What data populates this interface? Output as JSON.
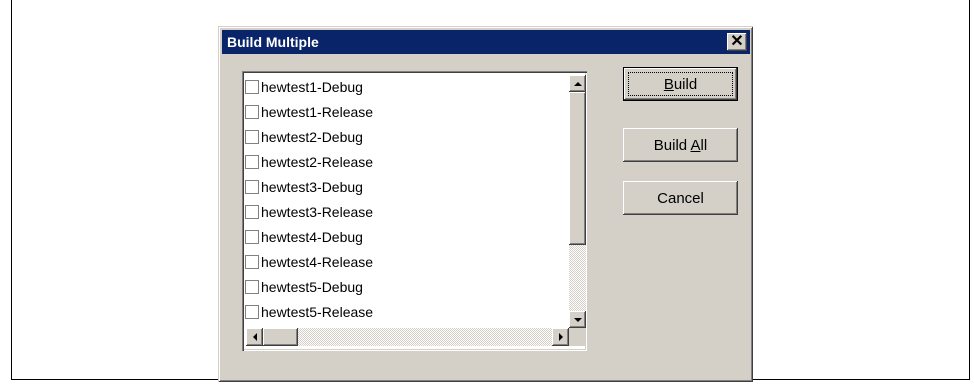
{
  "dialog": {
    "title": "Build Multiple",
    "close_label": "✕"
  },
  "list": {
    "items": [
      {
        "label": "hewtest1-Debug",
        "checked": false
      },
      {
        "label": "hewtest1-Release",
        "checked": false
      },
      {
        "label": "hewtest2-Debug",
        "checked": false
      },
      {
        "label": "hewtest2-Release",
        "checked": false
      },
      {
        "label": "hewtest3-Debug",
        "checked": false
      },
      {
        "label": "hewtest3-Release",
        "checked": false
      },
      {
        "label": "hewtest4-Debug",
        "checked": false
      },
      {
        "label": "hewtest4-Release",
        "checked": false
      },
      {
        "label": "hewtest5-Debug",
        "checked": false
      },
      {
        "label": "hewtest5-Release",
        "checked": false
      }
    ]
  },
  "buttons": {
    "build": {
      "pre": "",
      "accel": "B",
      "post": "uild"
    },
    "build_all": {
      "pre": "Build ",
      "accel": "A",
      "post": "ll"
    },
    "cancel": {
      "label": "Cancel"
    }
  },
  "colors": {
    "titlebar": "#0a246a",
    "face": "#d4d0c8"
  }
}
